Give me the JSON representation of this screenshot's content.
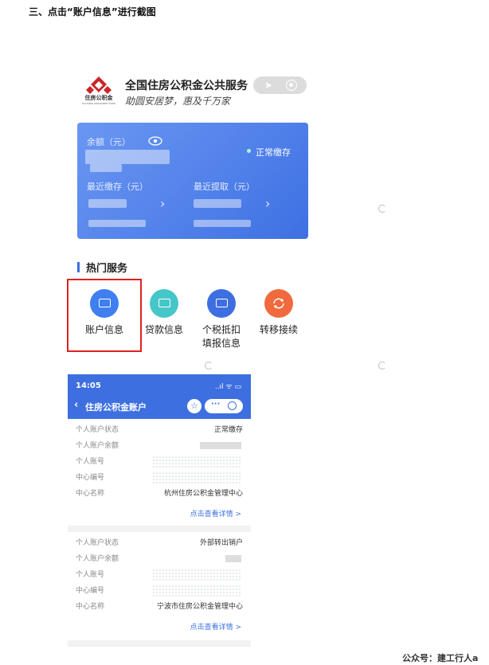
{
  "heading": "三、点击“账户信息”进行截图",
  "app": {
    "logo_text": "住房公积金",
    "logo_subtext": "HOUSING PROVIDENT FUND",
    "title": "全国住房公积金公共服务",
    "slogan": "助圆安居梦，惠及千万家"
  },
  "card": {
    "balance_label": "余额（元）",
    "status": "正常缴存",
    "recent_deposit_label": "最近缴存（元）",
    "recent_withdraw_label": "最近提取（元）"
  },
  "services": {
    "title": "热门服务",
    "items": [
      {
        "label": "账户信息",
        "color": "#3f7ff0"
      },
      {
        "label": "贷款信息",
        "color": "#45c6c8"
      },
      {
        "label": "个税抵扣填报信息",
        "line1": "个税抵扣",
        "line2": "填报信息",
        "color": "#3e6fe0"
      },
      {
        "label": "转移接续",
        "color": "#f06a3e"
      }
    ]
  },
  "phone": {
    "time": "14:05",
    "signal": "..ıl ᯤ ▭",
    "nav_title": "住房公积金账户",
    "star": "☆",
    "more": "···",
    "accounts": [
      {
        "status_label": "个人账户状态",
        "status_value": "正常缴存",
        "balance_label": "个人账户余额",
        "account_label": "个人账号",
        "center_code_label": "中心编号",
        "center_name_label": "中心名称",
        "center_name_value": "杭州住房公积金管理中心",
        "detail_link": "点击查看详情 >"
      },
      {
        "status_label": "个人账户状态",
        "status_value": "外部转出销户",
        "balance_label": "个人账户余额",
        "account_label": "个人账号",
        "center_code_label": "中心编号",
        "center_name_label": "中心名称",
        "center_name_value": "宁波市住房公积金管理中心",
        "detail_link": "点击查看详情 >"
      }
    ]
  },
  "footer": "公众号：建工行人a",
  "colors": {
    "accent": "#3e6fe0",
    "highlight": "#e02020"
  }
}
